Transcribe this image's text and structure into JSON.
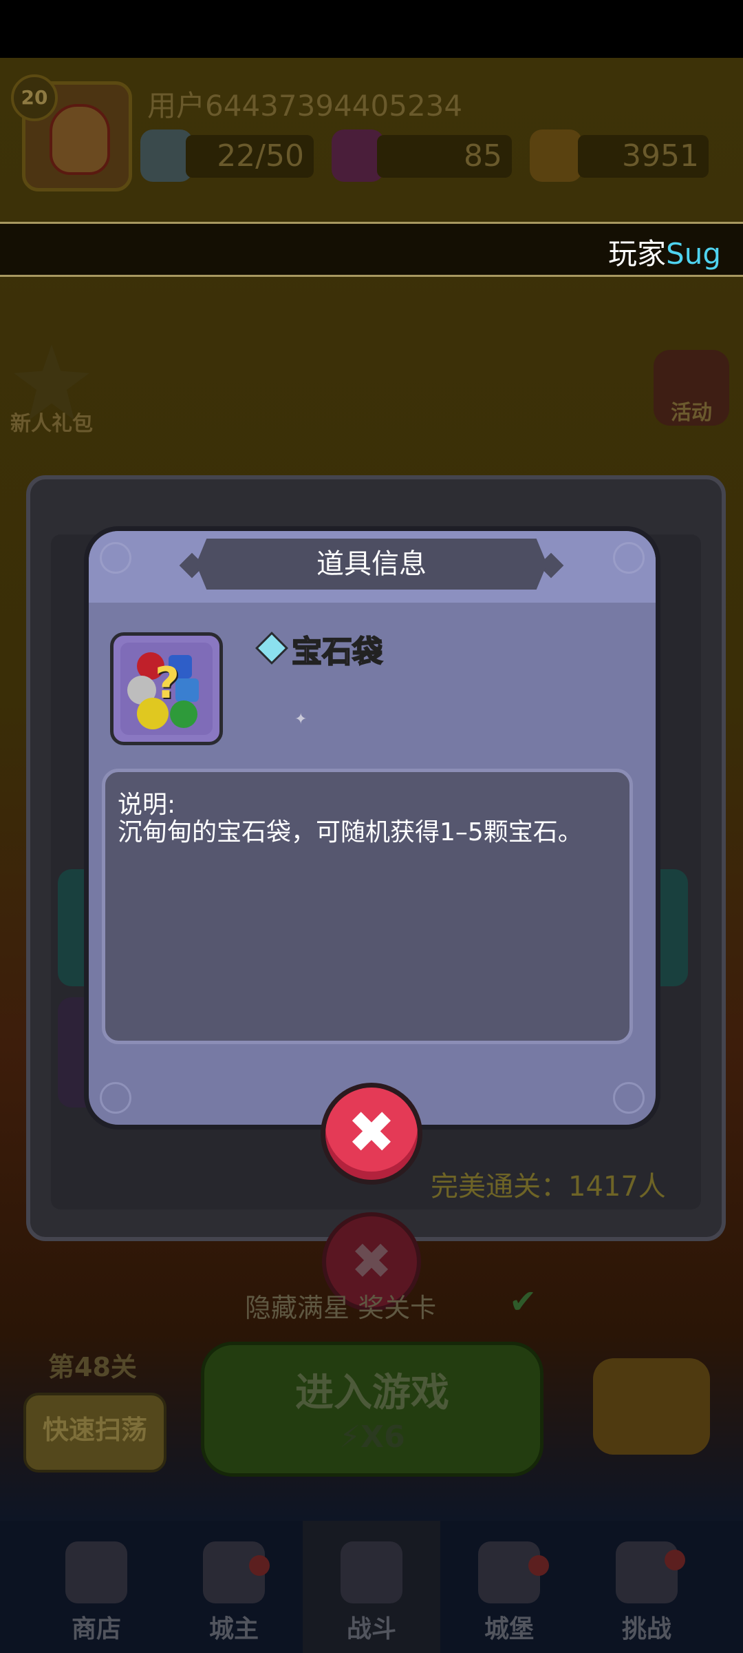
{
  "hud": {
    "level": "20",
    "username": "用户64437394405234",
    "energy": "22/50",
    "gems": "85",
    "gold": "3951"
  },
  "banner": {
    "prefix": "玩家",
    "highlight": "Sug"
  },
  "side": {
    "newbie_pack": "新人礼包",
    "activity": "活动"
  },
  "dialog": {
    "title": "道具信息",
    "item_name": "宝石袋",
    "desc_label": "说明:",
    "desc_text": "沉甸甸的宝石袋，可随机获得1–5颗宝石。",
    "close_symbol": "✖"
  },
  "behind": {
    "perfect_clear": "完美通关：1417人",
    "hidden_level": "隐藏满星     奖关卡",
    "level_label": "第48关",
    "sweep": "快速扫荡",
    "enter_game": "进入游戏",
    "energy_cost": "X6"
  },
  "nav": {
    "shop": "商店",
    "lord": "城主",
    "battle": "战斗",
    "castle": "城堡",
    "challenge": "挑战"
  },
  "colors": {
    "dialog_bg": "#777aa4",
    "accent_close": "#e43a56",
    "item_name": "#c89af5",
    "banner_highlight": "#4fd3f0"
  }
}
